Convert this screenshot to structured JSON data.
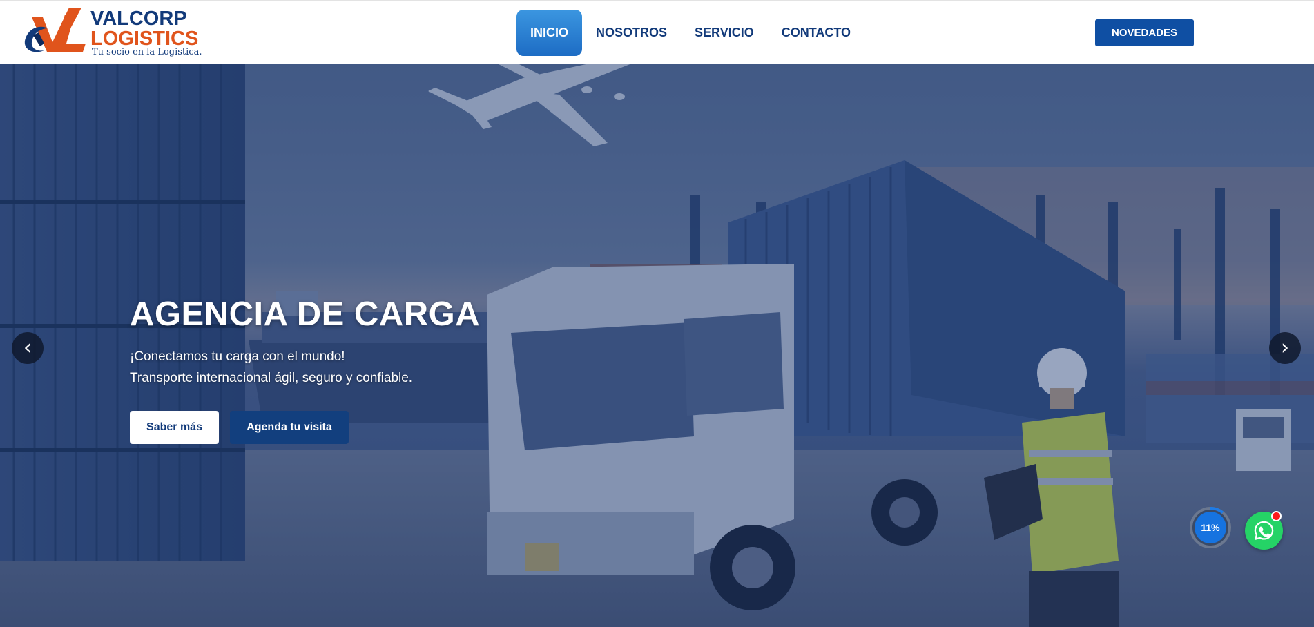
{
  "header": {
    "logo": {
      "word1": "VALCORP",
      "word2": "LOGISTICS",
      "tagline": "Tu socio en la Logistica."
    },
    "nav": {
      "items": [
        {
          "label": "INICIO",
          "active": true
        },
        {
          "label": "NOSOTROS",
          "active": false
        },
        {
          "label": "SERVICIO",
          "active": false
        },
        {
          "label": "CONTACTO",
          "active": false
        }
      ]
    },
    "novedades_label": "NOVEDADES"
  },
  "hero": {
    "title": "AGENCIA DE CARGA",
    "line1": "¡Conectamos tu carga con el mundo!",
    "line2": "Transporte internacional ágil, seguro y confiable.",
    "primary_button": "Saber más",
    "secondary_button": "Agenda tu visita",
    "prev_arrow": "‹",
    "next_arrow": "›"
  },
  "widgets": {
    "progress_percent": 11,
    "progress_label": "11%",
    "whatsapp_icon": "whatsapp-icon"
  },
  "colors": {
    "brand_navy": "#123a7a",
    "brand_orange": "#e0541c",
    "nav_active": "#1d6cc4",
    "novedades_bg": "#0f4fa3",
    "agenda_bg": "#123f7e",
    "whatsapp_green": "#25d366"
  }
}
